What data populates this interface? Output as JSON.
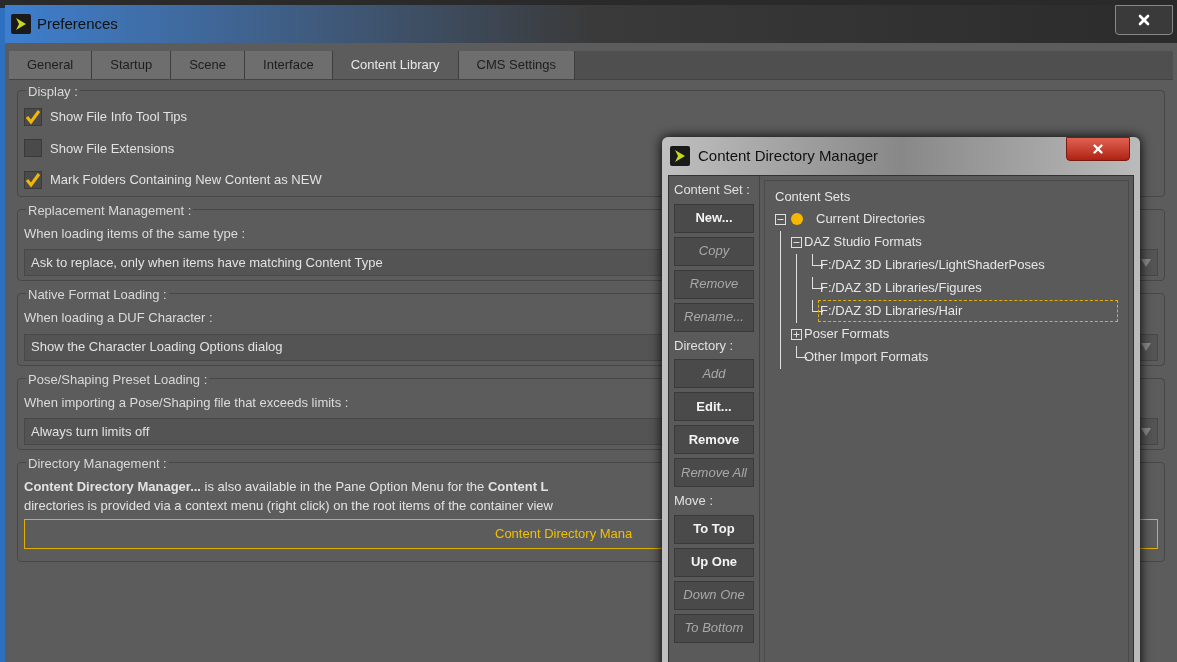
{
  "preferences": {
    "title": "Preferences",
    "tabs": [
      {
        "label": "General",
        "selected": false
      },
      {
        "label": "Startup",
        "selected": false
      },
      {
        "label": "Scene",
        "selected": false
      },
      {
        "label": "Interface",
        "selected": false
      },
      {
        "label": "Content Library",
        "selected": true
      },
      {
        "label": "CMS Settings",
        "selected": false
      }
    ],
    "display": {
      "title": "Display :",
      "options": [
        {
          "label": "Show File Info Tool Tips",
          "checked": true
        },
        {
          "label": "Show File Extensions",
          "checked": false
        },
        {
          "label": "Mark Folders Containing New Content as NEW",
          "checked": true
        }
      ]
    },
    "settings": [
      {
        "title": "Replacement Management :",
        "prompt": "When loading items of the same type :",
        "value": "Ask to replace, only when items have matching Content Type"
      },
      {
        "title": "Native Format Loading :",
        "prompt": "When loading a DUF Character :",
        "value": "Show the Character Loading Options dialog"
      },
      {
        "title": "Pose/Shaping Preset Loading :",
        "prompt": "When importing a Pose/Shaping file that exceeds limits :",
        "value": "Always turn limits off"
      }
    ],
    "directory_management": {
      "title": "Directory Management :",
      "description": [
        "**Content Directory Manager...** is also available in the Pane Option Menu for the **Content L**",
        "directories is provided via a context menu (right click) on the root items of the container view"
      ],
      "button": "Content Directory Mana"
    }
  },
  "dialog": {
    "title": "Content Directory Manager",
    "sections": [
      {
        "label": "Content Set :",
        "buttons": [
          {
            "label": "New...",
            "disabled": false
          },
          {
            "label": "Copy",
            "disabled": true
          },
          {
            "label": "Remove",
            "disabled": true
          },
          {
            "label": "Rename...",
            "disabled": true
          }
        ]
      },
      {
        "label": "Directory :",
        "buttons": [
          {
            "label": "Add",
            "disabled": true
          },
          {
            "label": "Edit...",
            "disabled": false
          },
          {
            "label": "Remove",
            "disabled": false
          },
          {
            "label": "Remove All",
            "disabled": true
          }
        ]
      },
      {
        "label": "Move :",
        "buttons": [
          {
            "label": "To Top",
            "disabled": false
          },
          {
            "label": "Up One",
            "disabled": false
          },
          {
            "label": "Down One",
            "disabled": true
          },
          {
            "label": "To Bottom",
            "disabled": true
          }
        ]
      }
    ],
    "tree": {
      "header": "Content Sets",
      "nodes": [
        {
          "label": "Current Directories",
          "expanded": true,
          "selected": false,
          "children": [
            {
              "label": "DAZ Studio Formats",
              "expanded": true,
              "selected": false,
              "children": [
                {
                  "label": "F:/DAZ 3D Libraries/LightShaderPoses",
                  "selected": false
                },
                {
                  "label": "F:/DAZ 3D Libraries/Figures",
                  "selected": false
                },
                {
                  "label": "F:/DAZ 3D Libraries/Hair",
                  "selected": true
                }
              ]
            },
            {
              "label": "Poser Formats",
              "expanded": false,
              "selected": false
            },
            {
              "label": "Other Import Formats",
              "selected": false
            }
          ]
        }
      ]
    }
  }
}
